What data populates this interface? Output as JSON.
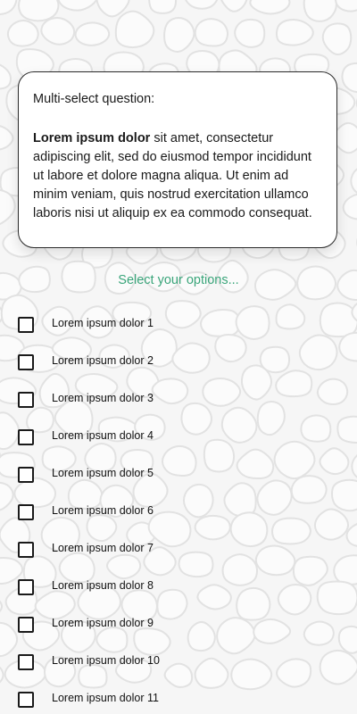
{
  "question": {
    "type_label": "Multi-select question:",
    "bold_lead": "Lorem ipsum dolor",
    "body_text": " sit amet, consectetur adipiscing elit, sed do eiusmod tempor incididunt ut labore et dolore magna aliqua. Ut enim ad minim veniam, quis nostrud exercitation ullamco laboris nisi ut aliquip ex ea commodo consequat."
  },
  "select_hint": "Select your options...",
  "options": [
    {
      "label": "Lorem ipsum dolor 1",
      "checked": false
    },
    {
      "label": "Lorem ipsum dolor 2",
      "checked": false
    },
    {
      "label": "Lorem ipsum dolor 3",
      "checked": false
    },
    {
      "label": "Lorem ipsum dolor 4",
      "checked": false
    },
    {
      "label": "Lorem ipsum dolor 5",
      "checked": false
    },
    {
      "label": "Lorem ipsum dolor 6",
      "checked": false
    },
    {
      "label": "Lorem ipsum dolor 7",
      "checked": false
    },
    {
      "label": "Lorem ipsum dolor 8",
      "checked": false
    },
    {
      "label": "Lorem ipsum dolor 9",
      "checked": false
    },
    {
      "label": "Lorem ipsum dolor 10",
      "checked": false
    },
    {
      "label": "Lorem ipsum dolor 11",
      "checked": false
    }
  ],
  "colors": {
    "accent": "#3aa57a",
    "background": "#f6f6f6",
    "pattern_line": "#e2e2e2"
  }
}
